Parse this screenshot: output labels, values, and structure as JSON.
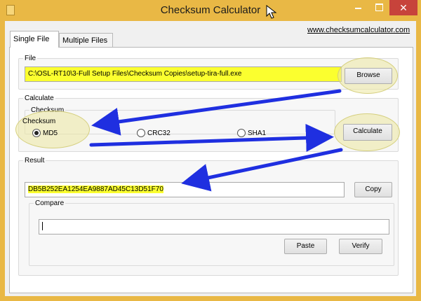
{
  "window": {
    "title": "Checksum Calculator",
    "close_symbol": "✕",
    "colors": {
      "titlebar": "#e9b845",
      "close": "#c7433b",
      "highlight": "#fbff2f",
      "arrow": "#1f2fe0"
    }
  },
  "tabs": [
    {
      "label": "Single File",
      "active": true
    },
    {
      "label": "Multiple Files",
      "active": false
    }
  ],
  "website_link": "www.checksumcalculator.com",
  "file_group": {
    "legend": "File",
    "path": "C:\\OSL-RT10\\3-Full Setup Files\\Checksum Copies\\setup-tira-full.exe",
    "browse_label": "Browse"
  },
  "calculate_group": {
    "legend": "Calculate",
    "checksum_legend": "Checksum",
    "options": [
      {
        "label": "MD5",
        "selected": true
      },
      {
        "label": "CRC32",
        "selected": false
      },
      {
        "label": "SHA1",
        "selected": false
      }
    ],
    "calculate_label": "Calculate"
  },
  "result_group": {
    "legend": "Result",
    "value": "DB5B252EA1254EA9887AD45C13D51F70",
    "copy_label": "Copy",
    "compare_legend": "Compare",
    "compare_value": "",
    "paste_label": "Paste",
    "verify_label": "Verify"
  }
}
